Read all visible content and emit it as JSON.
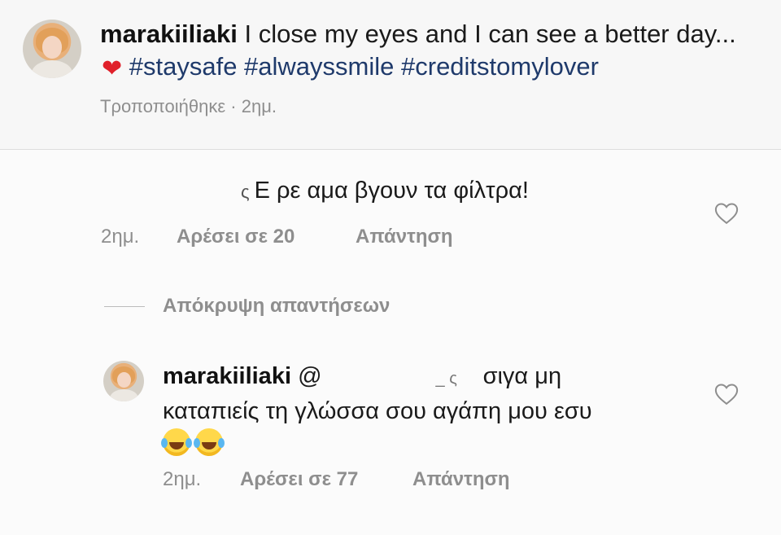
{
  "post": {
    "author": "marakiiliaki",
    "caption_text": " I close my eyes and I can see a better day...",
    "caption_emoji": "❤",
    "hashtags": " #staysafe #alwayssmile #creditstomylover",
    "edited_label": "Τροποποιήθηκε · 2ημ."
  },
  "comment": {
    "fragment": "ς",
    "text": "Ε ρε αμα βγουν τα φίλτρα!",
    "time": "2ημ.",
    "likes_label": "Αρέσει σε 20",
    "reply_label": "Απάντηση"
  },
  "hide_replies_label": "Απόκρυψη απαντήσεων",
  "reply": {
    "author": "marakiiliaki",
    "mention_prefix": "@",
    "redacted_tail": "_ ς",
    "text_line1": " σιγα μη",
    "text_line2": "καταπιείς τη γλώσσα σου αγάπη μου εσυ",
    "emoji_count": 2,
    "time": "2ημ.",
    "likes_label": "Αρέσει σε 77",
    "reply_label": "Απάντηση"
  },
  "colors": {
    "hashtag": "#1f3a6b",
    "meta_gray": "#8e8e8e",
    "heart_red": "#e0202a"
  }
}
